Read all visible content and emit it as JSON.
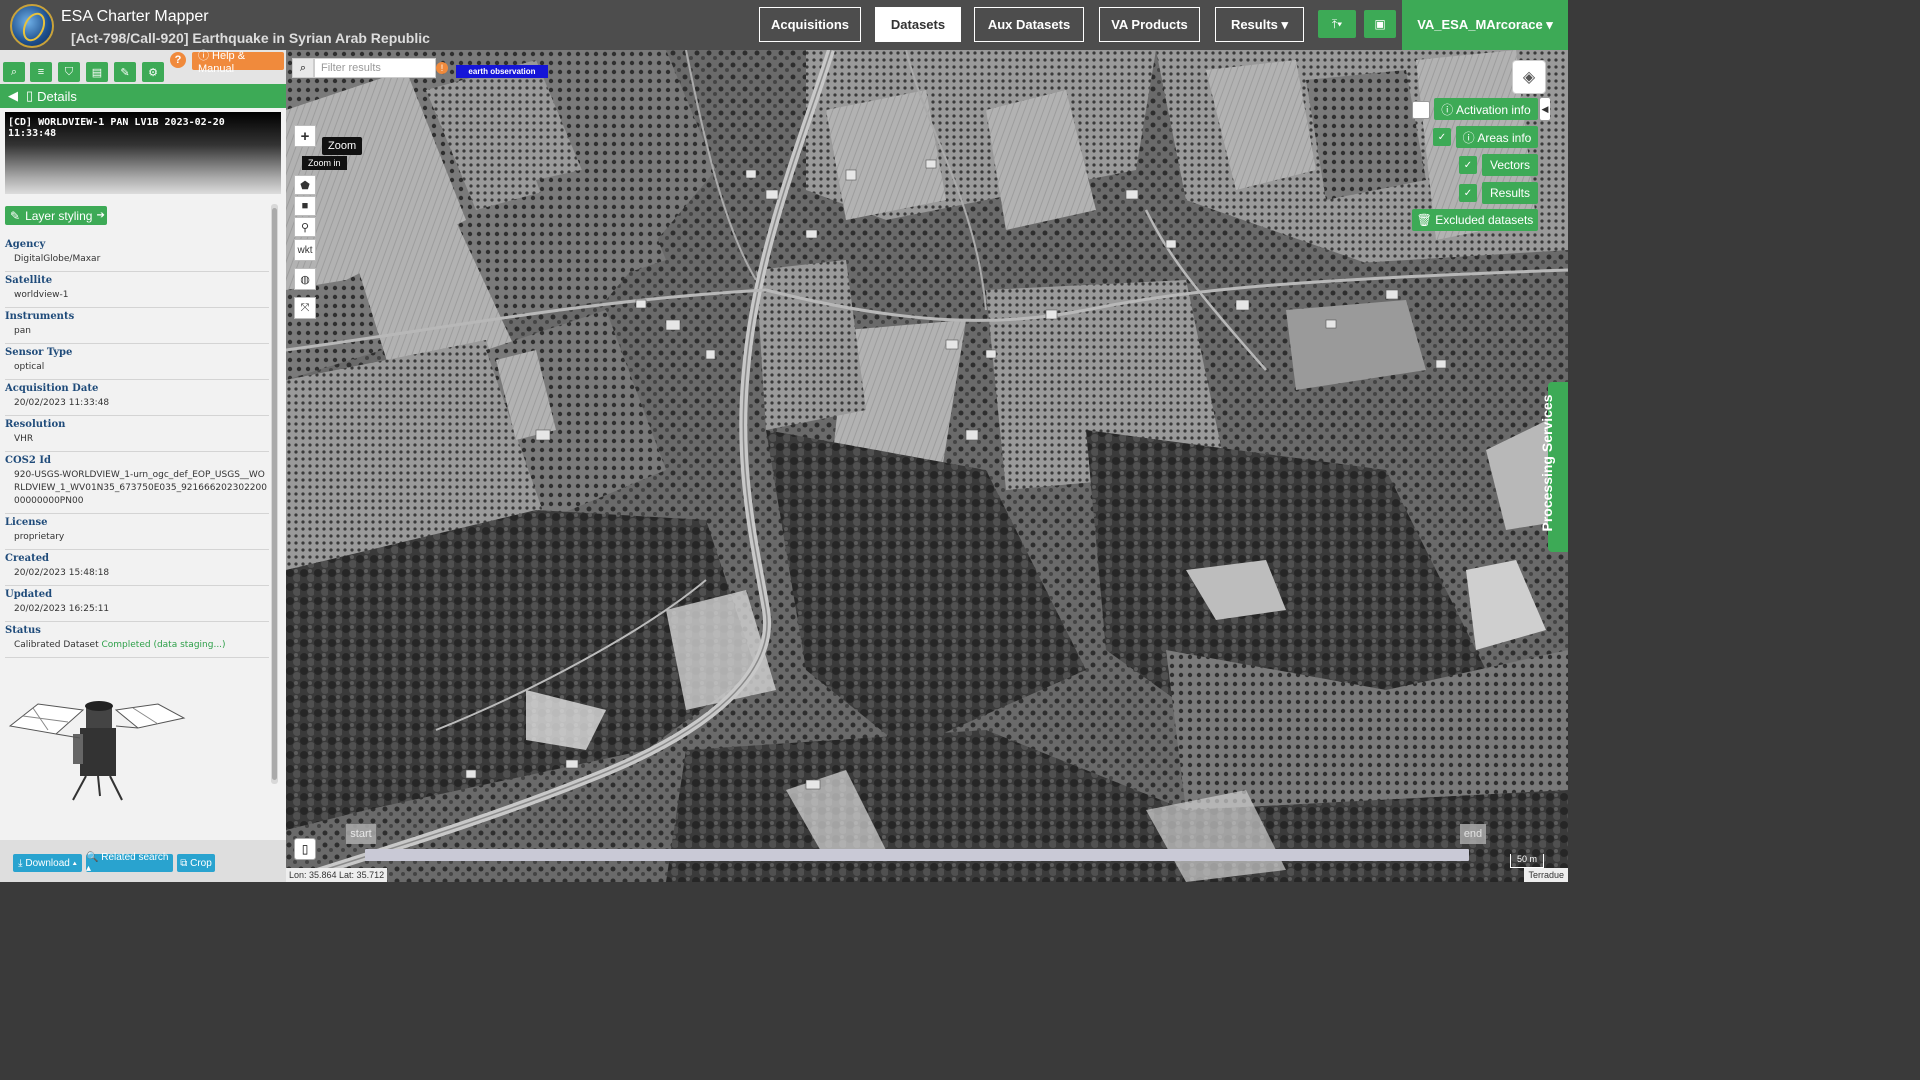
{
  "header": {
    "app_title": "ESA Charter Mapper",
    "subtitle": "[Act-798/Call-920] Earthquake in Syrian Arab Republic",
    "nav": [
      {
        "label": "Acquisitions",
        "active": false
      },
      {
        "label": "Datasets",
        "active": true
      },
      {
        "label": "Aux Datasets",
        "active": false
      },
      {
        "label": "VA Products",
        "active": false
      },
      {
        "label": "Results ▾",
        "active": false
      }
    ],
    "upload_icon": "upload-icon",
    "briefcase_icon": "briefcase-icon",
    "user": "VA_ESA_MArcorace ▾",
    "accent": "#3daa56"
  },
  "left_panel": {
    "toolbar_icons": [
      "search-icon",
      "list-icon",
      "basket-icon",
      "archive-icon",
      "pencil-icon",
      "gear-icon"
    ],
    "help_q": "?",
    "help_label": "ⓘ Help & Manual",
    "details_label": "Details",
    "preview_title": "[CD] WORLDVIEW-1 PAN LV1B 2023-02-20 11:33:48",
    "layer_styling": "Layer styling",
    "properties": [
      {
        "key": "Agency",
        "value": "DigitalGlobe/Maxar"
      },
      {
        "key": "Satellite",
        "value": "worldview-1"
      },
      {
        "key": "Instruments",
        "value": "pan"
      },
      {
        "key": "Sensor Type",
        "value": "optical"
      },
      {
        "key": "Acquisition Date",
        "value": "20/02/2023 11:33:48"
      },
      {
        "key": "Resolution",
        "value": "VHR"
      },
      {
        "key": "COS2 Id",
        "value": "920-USGS-WORLDVIEW_1-urn_ogc_def_EOP_USGS__WORLDVIEW_1_WV01N35_673750E035_92166620230220000000000PN00"
      },
      {
        "key": "License",
        "value": "proprietary"
      },
      {
        "key": "Created",
        "value": "20/02/2023 15:48:18"
      },
      {
        "key": "Updated",
        "value": "20/02/2023 16:25:11"
      },
      {
        "key": "Status",
        "value": "Calibrated Dataset",
        "value_extra": "Completed (data staging...)"
      }
    ],
    "bottom_buttons": [
      {
        "label": "⤓ Download ▴"
      },
      {
        "label": "🔍 Related search ▴"
      },
      {
        "label": "⧉ Crop"
      }
    ]
  },
  "map": {
    "filter_placeholder": "Filter results",
    "filter_badge": "!",
    "tag": "earth observation",
    "zoom_plus": "+",
    "zoom_tooltip": "Zoom",
    "zoom_in_tooltip": "Zoom in",
    "draw_tools": [
      "polygon-icon",
      "rectangle-icon",
      "marker-icon"
    ],
    "wkt_label": "wkt",
    "right_controls": {
      "activation_info": "ⓘ Activation info",
      "areas_info": "ⓘ Areas info",
      "vectors": "Vectors",
      "results": "Results",
      "excluded": "🗑 Excluded datasets",
      "check": "✓"
    },
    "processing_services": "Processing Services",
    "timeline_start": "start",
    "timeline_end": "end",
    "coords": "Lon: 35.864 Lat: 35.712",
    "scale": "50 m",
    "attribution": "Terradue"
  }
}
